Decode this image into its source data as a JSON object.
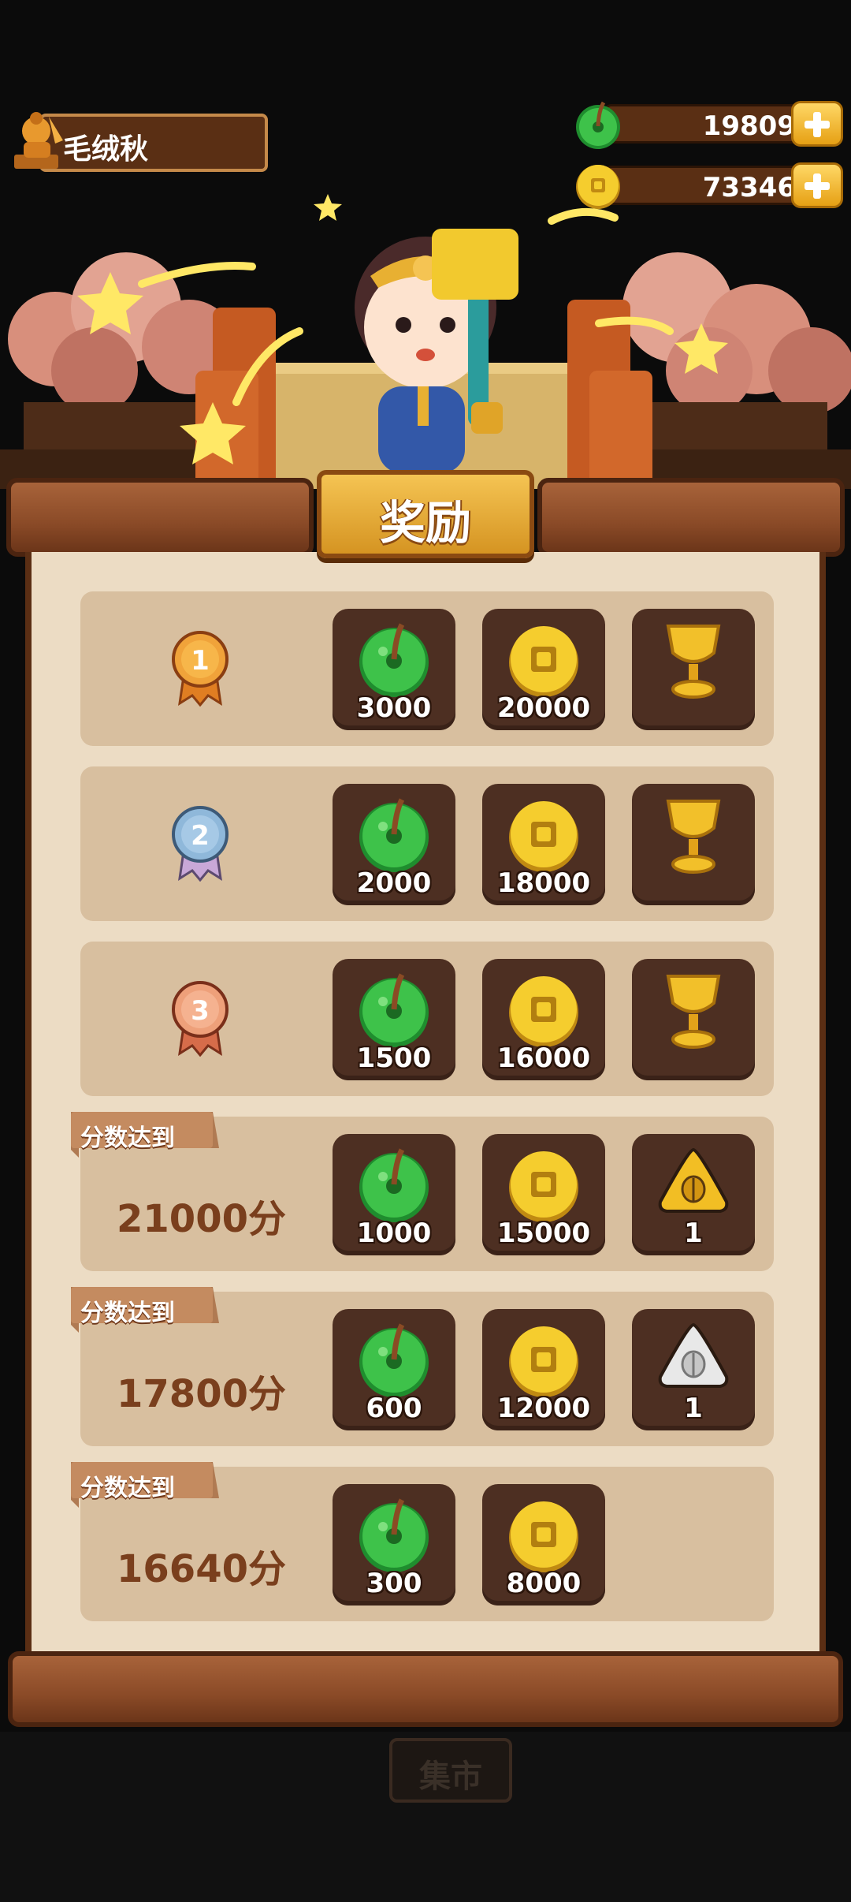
{
  "player": {
    "name": "毛绒秋"
  },
  "resources": [
    {
      "icon": "green-jade-coin-icon",
      "value": "19809"
    },
    {
      "icon": "gold-coin-icon",
      "value": "73346"
    }
  ],
  "title": "奖励",
  "rewards": [
    {
      "rank": "1",
      "medal_color": "#f0a33a",
      "items": [
        {
          "icon": "green-jade-coin-icon",
          "qty": "3000"
        },
        {
          "icon": "gold-coin-icon",
          "qty": "20000"
        },
        {
          "icon": "golden-trophy-icon",
          "qty": ""
        }
      ]
    },
    {
      "rank": "2",
      "medal_color": "#8fb8da",
      "items": [
        {
          "icon": "green-jade-coin-icon",
          "qty": "2000"
        },
        {
          "icon": "gold-coin-icon",
          "qty": "18000"
        },
        {
          "icon": "golden-trophy-icon",
          "qty": ""
        }
      ]
    },
    {
      "rank": "3",
      "medal_color": "#eea07a",
      "items": [
        {
          "icon": "green-jade-coin-icon",
          "qty": "1500"
        },
        {
          "icon": "gold-coin-icon",
          "qty": "16000"
        },
        {
          "icon": "golden-trophy-icon",
          "qty": ""
        }
      ]
    },
    {
      "condition": "分数达到",
      "score": "21000分",
      "items": [
        {
          "icon": "green-jade-coin-icon",
          "qty": "1000"
        },
        {
          "icon": "gold-coin-icon",
          "qty": "15000"
        },
        {
          "icon": "gold-beetle-badge-icon",
          "qty": "1"
        }
      ]
    },
    {
      "condition": "分数达到",
      "score": "17800分",
      "items": [
        {
          "icon": "green-jade-coin-icon",
          "qty": "600"
        },
        {
          "icon": "gold-coin-icon",
          "qty": "12000"
        },
        {
          "icon": "silver-beetle-badge-icon",
          "qty": "1"
        }
      ]
    },
    {
      "condition": "分数达到",
      "score": "16640分",
      "items": [
        {
          "icon": "green-jade-coin-icon",
          "qty": "300"
        },
        {
          "icon": "gold-coin-icon",
          "qty": "8000"
        }
      ]
    }
  ],
  "background": {
    "market_label": "集市"
  }
}
